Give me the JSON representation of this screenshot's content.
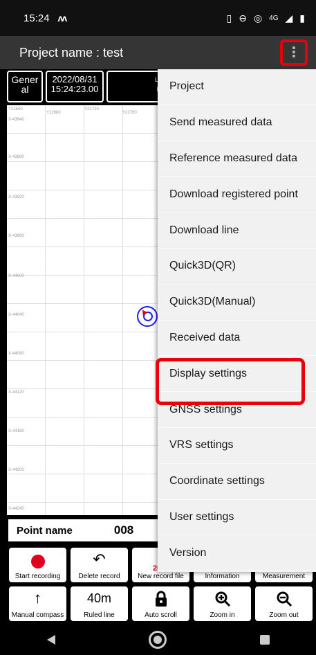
{
  "status": {
    "time": "15:24",
    "app_indicator": "M",
    "network": "4G"
  },
  "app_bar": {
    "title": "Project name : test"
  },
  "info": {
    "mode_line1": "Gener",
    "mode_line2": "al",
    "date": "2022/08/31",
    "time": "15:24:23.00",
    "partial_1": "L",
    "partial_2": "I"
  },
  "map": {
    "x_labels": [
      "Y22640",
      "Y22680",
      "Y22720",
      "Y22760"
    ],
    "y_labels": [
      "X-43640",
      "X-43880",
      "X-43920",
      "X-43960",
      "X-44000",
      "X-44040",
      "X-44080",
      "X-44120",
      "X-44160",
      "X-44200",
      "X-44240"
    ]
  },
  "point": {
    "label": "Point name",
    "value": "008"
  },
  "toolbar_row1": [
    {
      "label": "Start recording",
      "icon": "record-icon"
    },
    {
      "label": "Delete record",
      "icon": "undo-icon"
    },
    {
      "label": "New record file",
      "icon": "new-file-icon",
      "overlay": "2022"
    },
    {
      "label": "Information",
      "icon": "info-icon"
    },
    {
      "label": "Measurement",
      "icon": "measure-icon"
    }
  ],
  "toolbar_row2": [
    {
      "label": "Manual compass",
      "icon": "arrow-up-icon",
      "glyph": "↑"
    },
    {
      "label": "Ruled line",
      "icon": "ruler-text",
      "glyph": "40m"
    },
    {
      "label": "Auto scroll",
      "icon": "lock-icon"
    },
    {
      "label": "Zoom in",
      "icon": "zoom-in-icon"
    },
    {
      "label": "Zoom out",
      "icon": "zoom-out-icon"
    }
  ],
  "menu": {
    "items": [
      "Project",
      "Send measured data",
      "Reference measured data",
      "Download registered point",
      "Download line",
      "Quick3D(QR)",
      "Quick3D(Manual)",
      "Received data",
      "Display settings",
      "GNSS settings",
      "VRS settings",
      "Coordinate settings",
      "User settings",
      "Version"
    ],
    "highlighted": "Display settings"
  },
  "colors": {
    "highlight": "#e8000d",
    "record": "#e0001d",
    "marker": "#1c1cf5"
  }
}
